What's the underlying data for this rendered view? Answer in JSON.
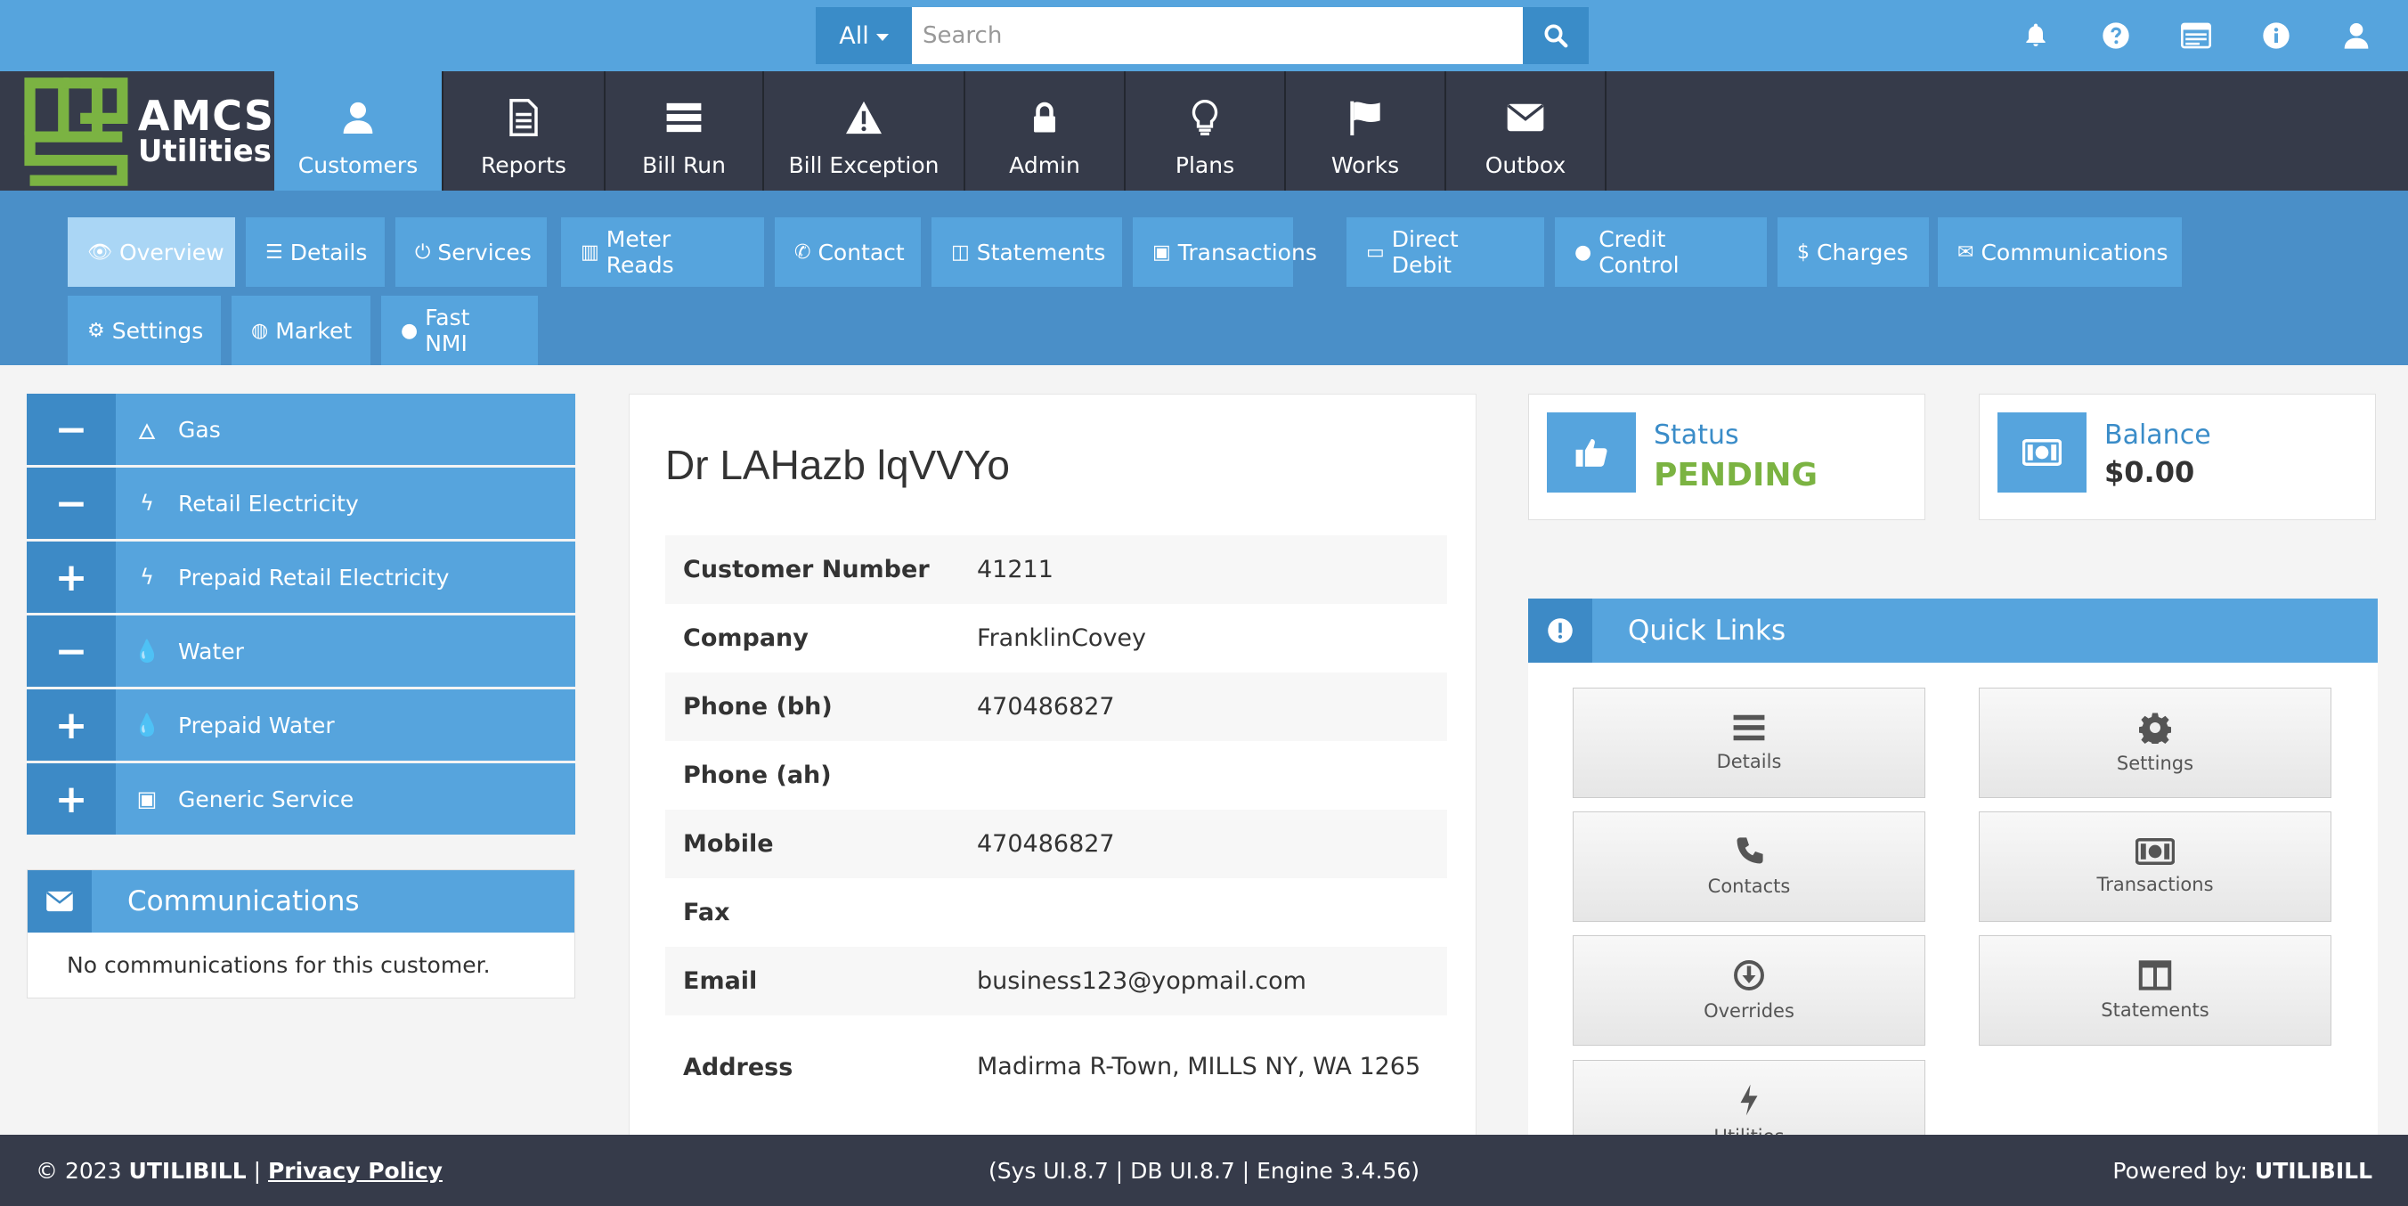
{
  "search": {
    "scope": "All",
    "placeholder": "Search"
  },
  "brand": {
    "line1": "AMCS",
    "line2": "Utilities"
  },
  "main_nav": [
    {
      "label": "Customers",
      "icon": "user-icon",
      "active": true
    },
    {
      "label": "Reports",
      "icon": "report-icon"
    },
    {
      "label": "Bill Run",
      "icon": "bill-run-icon"
    },
    {
      "label": "Bill Exception",
      "icon": "warning-icon"
    },
    {
      "label": "Admin",
      "icon": "lock-icon"
    },
    {
      "label": "Plans",
      "icon": "lightbulb-icon"
    },
    {
      "label": "Works",
      "icon": "flag-icon"
    },
    {
      "label": "Outbox",
      "icon": "envelope-icon"
    }
  ],
  "sub_tabs": [
    {
      "label": "Overview",
      "icon": "eye-icon",
      "active": true
    },
    {
      "label": "Details",
      "icon": "list-icon"
    },
    {
      "label": "Services",
      "icon": "power-icon"
    },
    {
      "label": "Meter Reads",
      "icon": "bar-chart-icon"
    },
    {
      "label": "Contact",
      "icon": "phone-icon"
    },
    {
      "label": "Statements",
      "icon": "columns-icon"
    },
    {
      "label": "Transactions",
      "icon": "money-icon"
    },
    {
      "label": "Direct Debit",
      "icon": "credit-card-icon"
    },
    {
      "label": "Credit Control",
      "icon": "user-icon"
    },
    {
      "label": "Charges",
      "icon": "dollar-icon"
    },
    {
      "label": "Communications",
      "icon": "envelope-icon"
    },
    {
      "label": "Settings",
      "icon": "gear-icon"
    },
    {
      "label": "Market",
      "icon": "globe-icon"
    },
    {
      "label": "Fast NMI",
      "icon": "user-icon"
    }
  ],
  "services": [
    {
      "toggle": "−",
      "icon": "fire-icon",
      "label": "Gas"
    },
    {
      "toggle": "−",
      "icon": "bolt-icon",
      "label": "Retail Electricity"
    },
    {
      "toggle": "+",
      "icon": "bolt-icon",
      "label": "Prepaid Retail Electricity"
    },
    {
      "toggle": "−",
      "icon": "drop-icon",
      "label": "Water"
    },
    {
      "toggle": "+",
      "icon": "drop-icon",
      "label": "Prepaid Water"
    },
    {
      "toggle": "+",
      "icon": "money-icon",
      "label": "Generic Service"
    }
  ],
  "communications": {
    "title": "Communications",
    "empty_text": "No communications for this customer."
  },
  "customer": {
    "name": "Dr LAHazb lqVVYo",
    "fields": [
      {
        "label": "Customer Number",
        "value": "41211"
      },
      {
        "label": "Company",
        "value": "FranklinCovey"
      },
      {
        "label": "Phone (bh)",
        "value": "470486827"
      },
      {
        "label": "Phone (ah)",
        "value": ""
      },
      {
        "label": "Mobile",
        "value": "470486827"
      },
      {
        "label": "Fax",
        "value": ""
      },
      {
        "label": "Email",
        "value": "business123@yopmail.com"
      },
      {
        "label": "Address",
        "value": "Madirma R-Town, MILLS NY, WA 1265"
      }
    ]
  },
  "status": {
    "label": "Status",
    "value": "PENDING",
    "value_color": "#7bb342"
  },
  "balance": {
    "label": "Balance",
    "value": "$0.00"
  },
  "quick_links": {
    "title": "Quick Links",
    "items": [
      {
        "label": "Details",
        "icon": "list-icon"
      },
      {
        "label": "Settings",
        "icon": "gear-icon"
      },
      {
        "label": "Contacts",
        "icon": "phone-icon"
      },
      {
        "label": "Transactions",
        "icon": "money-icon"
      },
      {
        "label": "Overrides",
        "icon": "download-circle-icon"
      },
      {
        "label": "Statements",
        "icon": "columns-icon"
      },
      {
        "label": "Utilities",
        "icon": "bolt-icon"
      }
    ]
  },
  "footer": {
    "copyright": "© 2023",
    "company": "UTILIBILL",
    "separator": "|",
    "privacy": "Privacy Policy",
    "versions": "(Sys UI.8.7 | DB UI.8.7 | Engine 3.4.56)",
    "powered_label": "Powered by:",
    "powered_name": "UTILIBILL"
  },
  "colors": {
    "primary": "#56a4dd",
    "primary_dark": "#3d8ac6",
    "nav_dark": "#363b4a",
    "logo_green": "#7bb342"
  }
}
